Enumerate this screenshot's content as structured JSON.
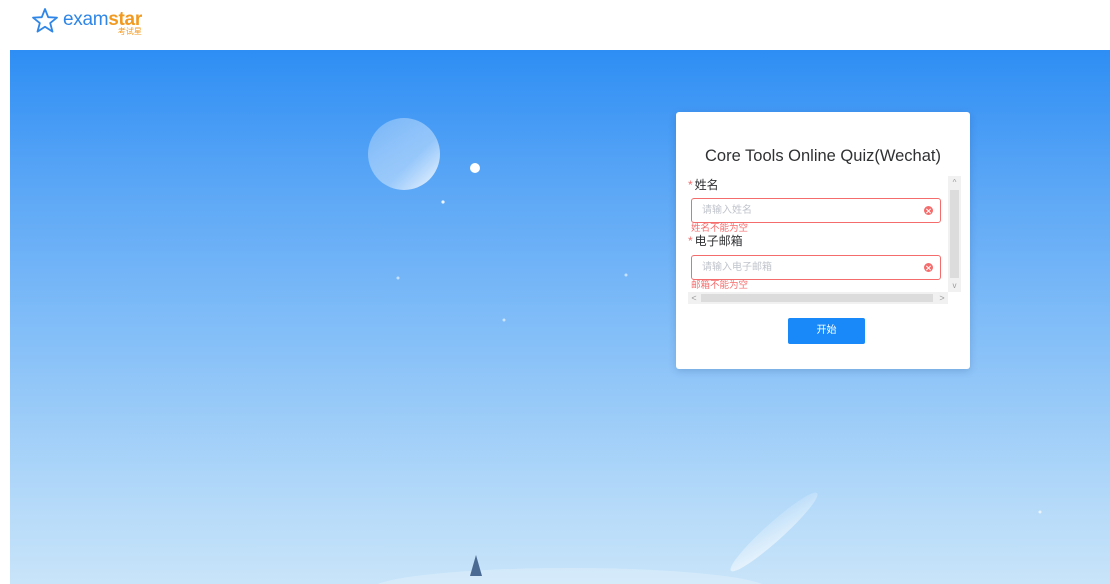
{
  "header": {
    "logo": {
      "word_exam": "exam",
      "word_star": "star",
      "subtitle": "考试星",
      "icon": "star-icon"
    }
  },
  "quiz_card": {
    "title": "Core Tools Online Quiz(Wechat)",
    "fields": [
      {
        "required_mark": "*",
        "label": "姓名",
        "value": "",
        "placeholder": "请输入姓名",
        "error": "姓名不能为空",
        "clear_icon": "clear-circle-icon"
      },
      {
        "required_mark": "*",
        "label": "电子邮箱",
        "value": "",
        "placeholder": "请输入电子邮箱",
        "error": "邮箱不能为空",
        "clear_icon": "clear-circle-icon"
      }
    ],
    "scrollbars": {
      "up_arrow": "^",
      "down_arrow": "v",
      "left_arrow": "<",
      "right_arrow": ">"
    },
    "submit_label": "开始"
  },
  "colors": {
    "brand_blue": "#2f86e6",
    "brand_orange": "#f29a1f",
    "primary_button": "#1989fa",
    "error_red": "#f56c6c",
    "hero_top": "#2e8ef4",
    "hero_bottom": "#c8e4f9"
  }
}
